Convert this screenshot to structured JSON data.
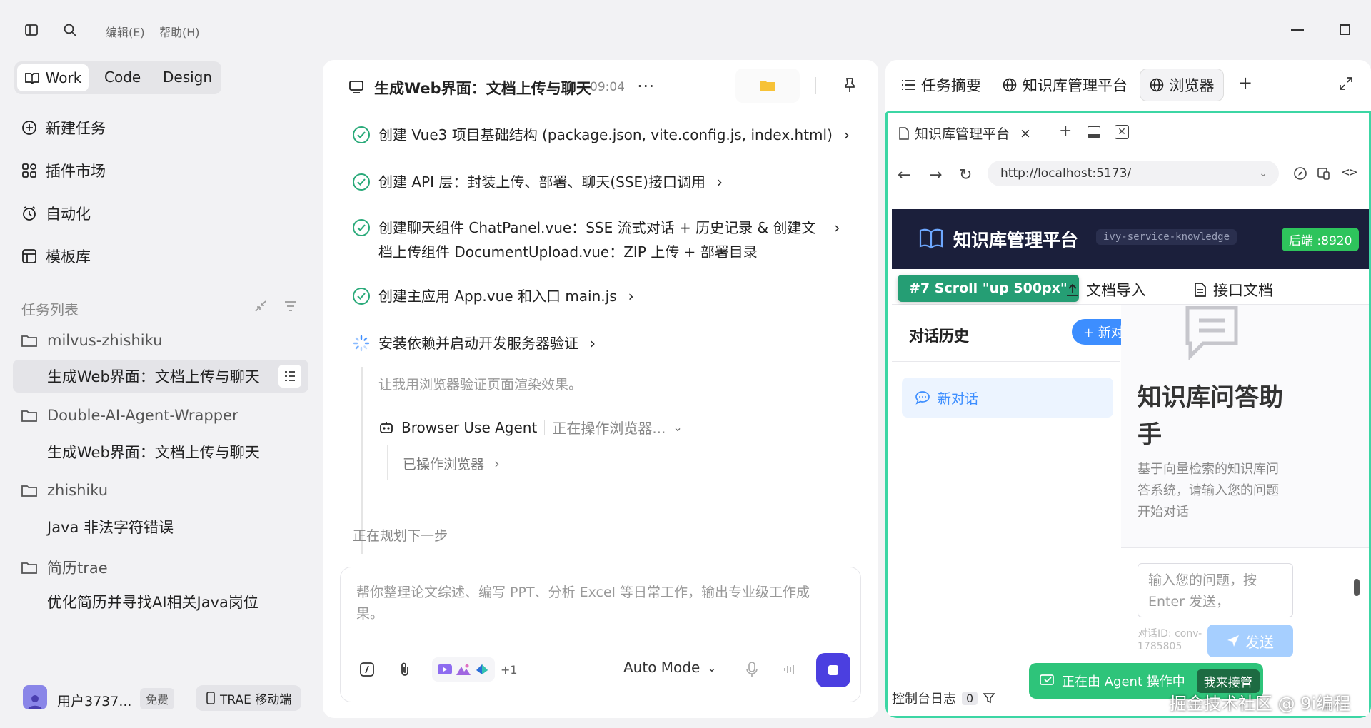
{
  "menu": {
    "edit": "编辑(E)",
    "help": "帮助(H)"
  },
  "modes": {
    "work": "Work",
    "code": "Code",
    "design": "Design"
  },
  "sidebar": {
    "new_task": "新建任务",
    "plugins": "插件市场",
    "automation": "自动化",
    "templates": "模板库",
    "task_list_title": "任务列表",
    "groups": [
      {
        "folder": "milvus-zhishiku",
        "tasks": [
          "生成Web界面：文档上传与聊天"
        ]
      },
      {
        "folder": "Double-AI-Agent-Wrapper",
        "tasks": [
          "生成Web界面：文档上传与聊天"
        ]
      },
      {
        "folder": "zhishiku",
        "tasks": [
          "Java 非法字符错误"
        ]
      },
      {
        "folder": "简历trae",
        "tasks": [
          "优化简历并寻找AI相关Java岗位"
        ]
      }
    ],
    "user": {
      "name": "用户3737...",
      "plan": "免费",
      "mobile": "TRAE 移动端"
    }
  },
  "chat": {
    "title": "生成Web界面：文档上传与聊天",
    "time": "09:04",
    "steps": [
      {
        "line1": "创建 Vue3 项目基础结构 (package.json, vite.config.js, index.html)",
        "line2": ""
      },
      {
        "line1": "创建 API 层：封装上传、部署、聊天(SSE)接口调用",
        "line2": ""
      },
      {
        "line1": "创建聊天组件 ChatPanel.vue：SSE 流式对话 + 历史记录 & 创建文",
        "line2": "档上传组件 DocumentUpload.vue：ZIP 上传 + 部署目录"
      },
      {
        "line1": "创建主应用 App.vue 和入口 main.js",
        "line2": ""
      }
    ],
    "running_step": "安装依赖并启动开发服务器验证",
    "sub_note": "让我用浏览器验证页面渲染效果。",
    "agent_name": "Browser Use Agent",
    "agent_status": "正在操作浏览器...",
    "agent_done": "已操作浏览器",
    "planning": "正在规划下一步",
    "input_placeholder": "帮你整理论文综述、编写 PPT、分析 Excel 等日常工作，输出专业级工作成果。",
    "plus_count": "+1",
    "mode": "Auto Mode"
  },
  "right": {
    "tabs": [
      "任务摘要",
      "知识库管理平台",
      "浏览器"
    ],
    "browser_tab": "知识库管理平台",
    "url": "http://localhost:5173/",
    "app": {
      "title": "知识库管理平台",
      "service": "ivy-service-knowledge",
      "backend": "后端 :8920",
      "scroll_badge": "#7 Scroll \"up 500px\"",
      "nav_import": "文档导入",
      "nav_api": "接口文档",
      "history_title": "对话历史",
      "new_chat_btn": "+ 新对话",
      "history_item": "新对话",
      "hero_title_1": "知识库问答助",
      "hero_title_2": "手",
      "hero_desc_1": "基于向量检索的知识库问",
      "hero_desc_2": "答系统，请输入您的问题",
      "hero_desc_3": "开始对话",
      "input_ph_1": "输入您的问题，按",
      "input_ph_2": "Enter 发送，",
      "conv_id_1": "对话ID: conv-",
      "conv_id_2": "1785805",
      "send": "发送"
    },
    "console": "控制台日志",
    "console_count": "0",
    "agent_banner": "正在由 Agent 操作中",
    "takeover": "我来接管"
  },
  "watermark": "掘金技术社区 @ 9i编程",
  "colors": {
    "accent": "#2aaa7a",
    "blue": "#3d8eff",
    "dark_header": "#1b1f3b",
    "browser_border": "#3cd6a4",
    "stop_button": "#4b3fe0"
  }
}
